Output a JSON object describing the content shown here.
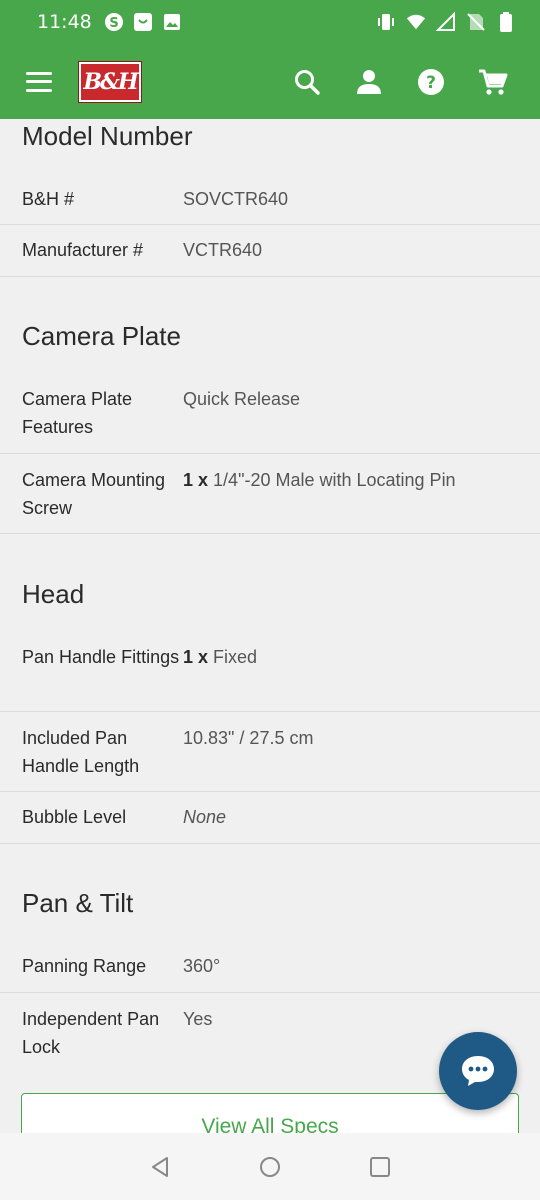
{
  "status_bar": {
    "time": "11:48",
    "left_icons": [
      "s-circle-icon",
      "shopping-bag-icon",
      "image-icon"
    ],
    "right_icons": [
      "vibrate-icon",
      "wifi-icon",
      "signal-icon",
      "no-sim-icon",
      "battery-icon"
    ]
  },
  "header": {
    "logo_text": "B&H",
    "brand_color": "#48a74b",
    "actions": [
      "search-icon",
      "account-icon",
      "help-icon",
      "cart-icon"
    ]
  },
  "sections": [
    {
      "title": "Model Number",
      "rows": [
        {
          "label": "B&H #",
          "value": "SOVCTR640"
        },
        {
          "label": "Manufacturer #",
          "value": "VCTR640"
        }
      ]
    },
    {
      "title": "Camera Plate",
      "rows": [
        {
          "label": "Camera Plate Features",
          "value": "Quick Release"
        },
        {
          "label": "Camera Mounting Screw",
          "qty": "1 x",
          "value": "1/4\"-20 Male with Locating Pin"
        }
      ]
    },
    {
      "title": "Head",
      "rows": [
        {
          "label": "Pan Handle Fittings",
          "qty": "1 x",
          "value": "Fixed"
        },
        {
          "label": "Included Pan Handle Length",
          "value": "10.83\" / 27.5 cm"
        },
        {
          "label": "Bubble Level",
          "value": "None"
        }
      ]
    },
    {
      "title": "Pan & Tilt",
      "rows": [
        {
          "label": "Panning Range",
          "value": "360°"
        },
        {
          "label": "Independent Pan Lock",
          "value": "Yes"
        }
      ]
    }
  ],
  "view_all_label": "View All Specs",
  "chat_icon": "chat-bubble-icon",
  "nav": [
    "back-icon",
    "home-icon",
    "recents-icon"
  ]
}
